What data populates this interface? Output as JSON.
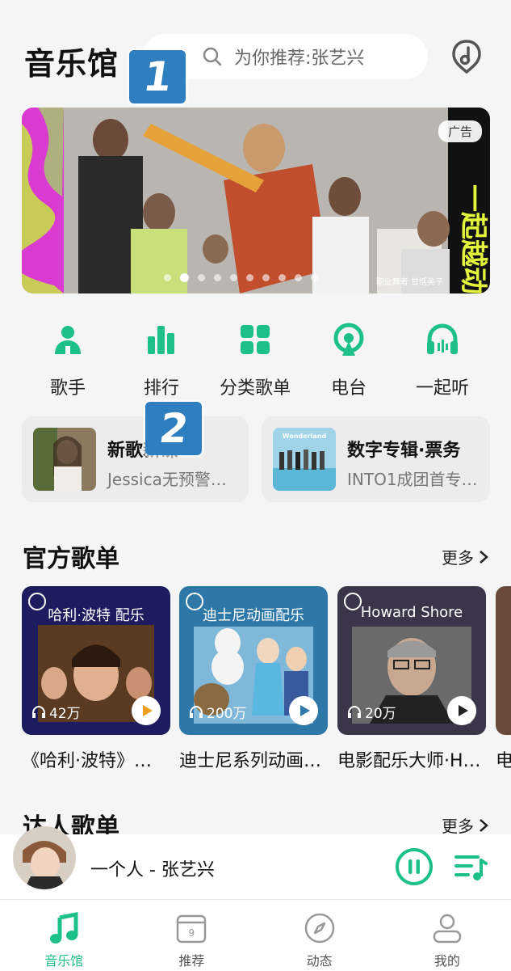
{
  "header": {
    "title": "音乐馆",
    "search_placeholder": "为你推荐:张艺兴",
    "marker1": "1",
    "marker2": "2"
  },
  "banner": {
    "ad_badge": "广告",
    "caption": "职业舞者 甘恬美子",
    "dot_count": 10,
    "active_dot": 1
  },
  "quick_nav": [
    {
      "label": "歌手",
      "icon": "singer-icon"
    },
    {
      "label": "排行",
      "icon": "ranking-icon"
    },
    {
      "label": "分类歌单",
      "icon": "category-icon"
    },
    {
      "label": "电台",
      "icon": "radio-icon"
    },
    {
      "label": "一起听",
      "icon": "listen-together-icon"
    }
  ],
  "cards": [
    {
      "title": "新歌新碟",
      "subtitle": "Jessica无预警…"
    },
    {
      "title": "数字专辑·票务",
      "subtitle": "INTO1成团首专…"
    }
  ],
  "official": {
    "title": "官方歌单",
    "more": "更多",
    "playlists": [
      {
        "cover_text": "哈利·波特 配乐",
        "plays": "42万",
        "name": "《哈利·波特》…"
      },
      {
        "cover_text": "迪士尼动画配乐",
        "plays": "200万",
        "name": "迪士尼系列动画…"
      },
      {
        "cover_text": "Howard Shore",
        "plays": "20万",
        "name": "电影配乐大师·H…"
      }
    ],
    "partial_name": "电"
  },
  "talent": {
    "title": "达人歌单",
    "more": "更多"
  },
  "player": {
    "song": "一个人 - 张艺兴"
  },
  "tabs": [
    {
      "label": "音乐馆",
      "active": true
    },
    {
      "label": "推荐",
      "active": false,
      "badge": "9"
    },
    {
      "label": "动态",
      "active": false
    },
    {
      "label": "我的",
      "active": false
    }
  ],
  "colors": {
    "accent": "#1ec08a",
    "marker": "#2f7fc0"
  }
}
